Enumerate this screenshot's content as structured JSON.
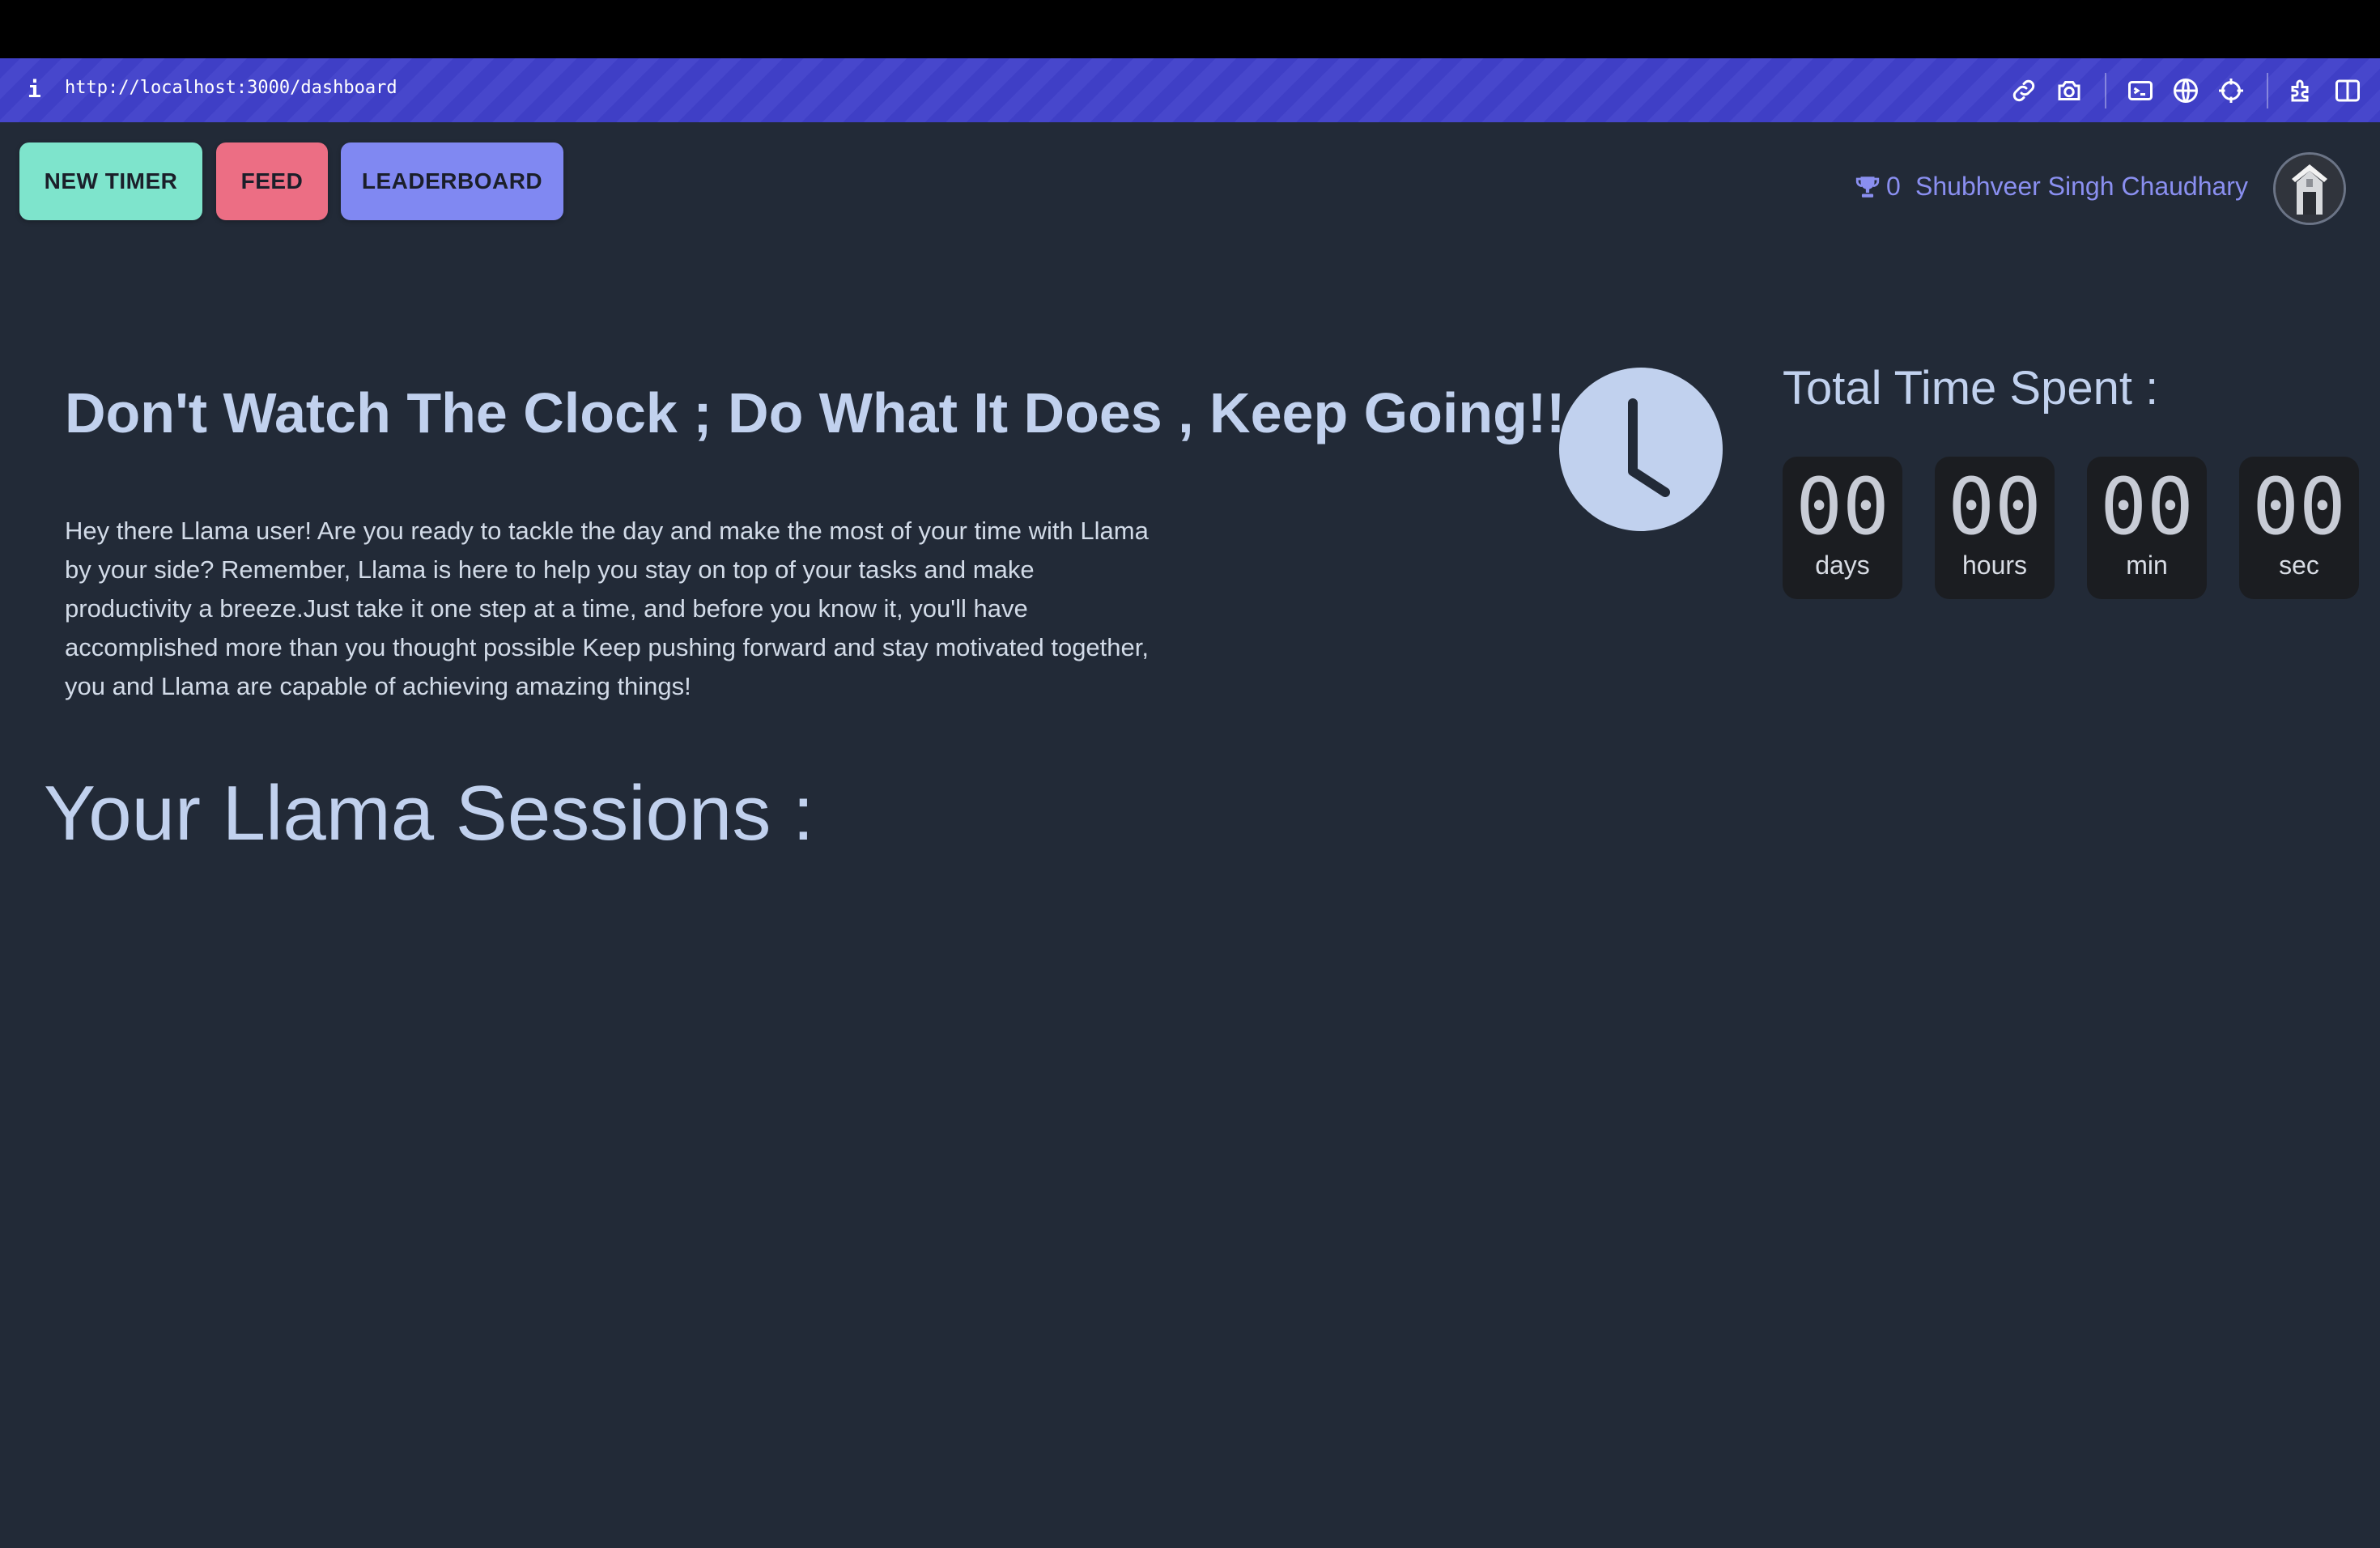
{
  "browser": {
    "info_icon": "info-icon",
    "url": "http://localhost:3000/dashboard",
    "toolbar_icons": [
      "link-icon",
      "camera-icon",
      "terminal-icon",
      "globe-icon",
      "crosshair-icon",
      "extension-icon",
      "sidebar-icon"
    ]
  },
  "nav": {
    "new_timer": "NEW TIMER",
    "feed": "FEED",
    "leaderboard": "LEADERBOARD"
  },
  "user": {
    "score": "0",
    "name": "Shubhveer Singh Chaudhary"
  },
  "hero": {
    "headline": "Don't Watch The Clock ; Do What It Does , Keep Going!!",
    "intro": "Hey there Llama user! Are you ready to tackle the day and make the most of your time with Llama by your side? Remember, Llama is here to help you stay on top of your tasks and make productivity a breeze.Just take it one step at a time, and before you know it, you'll have accomplished more than you thought possible Keep pushing forward and stay motivated together, you and Llama are capable of achieving amazing things!"
  },
  "total_time": {
    "title": "Total Time Spent :",
    "units": [
      {
        "value": "00",
        "label": "days"
      },
      {
        "value": "00",
        "label": "hours"
      },
      {
        "value": "00",
        "label": "min"
      },
      {
        "value": "00",
        "label": "sec"
      }
    ]
  },
  "sessions": {
    "title": "Your Llama Sessions :"
  },
  "colors": {
    "background": "#222a37",
    "url_bar": "#4343c9",
    "new_timer": "#7ee4cc",
    "feed": "#ec6e84",
    "leaderboard": "#8088f2",
    "heading_text": "#c1d1ee",
    "username": "#8a8ff0"
  }
}
